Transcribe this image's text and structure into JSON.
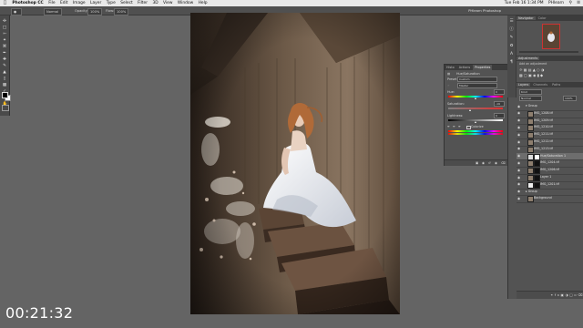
{
  "menubar": {
    "items": [
      "Photoshop CC",
      "File",
      "Edit",
      "Image",
      "Layer",
      "Type",
      "Select",
      "Filter",
      "3D",
      "View",
      "Window",
      "Help"
    ],
    "right": [
      "Tue Feb 16  1:34 PM",
      "PHlearn"
    ]
  },
  "optbar": {
    "field1": "Normal",
    "opacity_label": "Opacity:",
    "opacity": "100%",
    "flow_label": "Flow:",
    "flow": "100%",
    "doc_title": "PHlearn Photoshop"
  },
  "properties": {
    "tabs": [
      "Histo",
      "Actions",
      "Properties"
    ],
    "active_tab": "Properties",
    "title": "Hue/Saturation",
    "preset_label": "Preset:",
    "preset_value": "Custom",
    "channel_value": "Master",
    "hue_label": "Hue:",
    "hue_value": "0",
    "saturation_label": "Saturation:",
    "saturation_value": "-19",
    "lightness_label": "Lightness:",
    "lightness_value": "0",
    "colorize_label": "Colorize"
  },
  "navigator": {
    "tabs": [
      "Navigator",
      "Color"
    ]
  },
  "adjustments": {
    "title": "Adjustments",
    "subtitle": "Add an adjustment"
  },
  "layers_panel": {
    "tabs": [
      "Layers",
      "Channels",
      "Paths"
    ],
    "blend": "Normal",
    "opacity": "100%",
    "layers": [
      "Group",
      "IMG_1208.tif",
      "IMG_1209.tif",
      "IMG_1210.tif",
      "IMG_1211.tif",
      "IMG_1212.tif",
      "IMG_1213.tif",
      "Hue/Saturation 1",
      "IMG_1204.tif",
      "IMG_1206.tif",
      "Layer 1",
      "IMG_1201.tif",
      "Group",
      "Background"
    ]
  },
  "timer": "00:21:32",
  "colors": {
    "app_bg": "#646464",
    "panel_bg": "#535353",
    "menubar_bg": "#e9e9e9"
  }
}
